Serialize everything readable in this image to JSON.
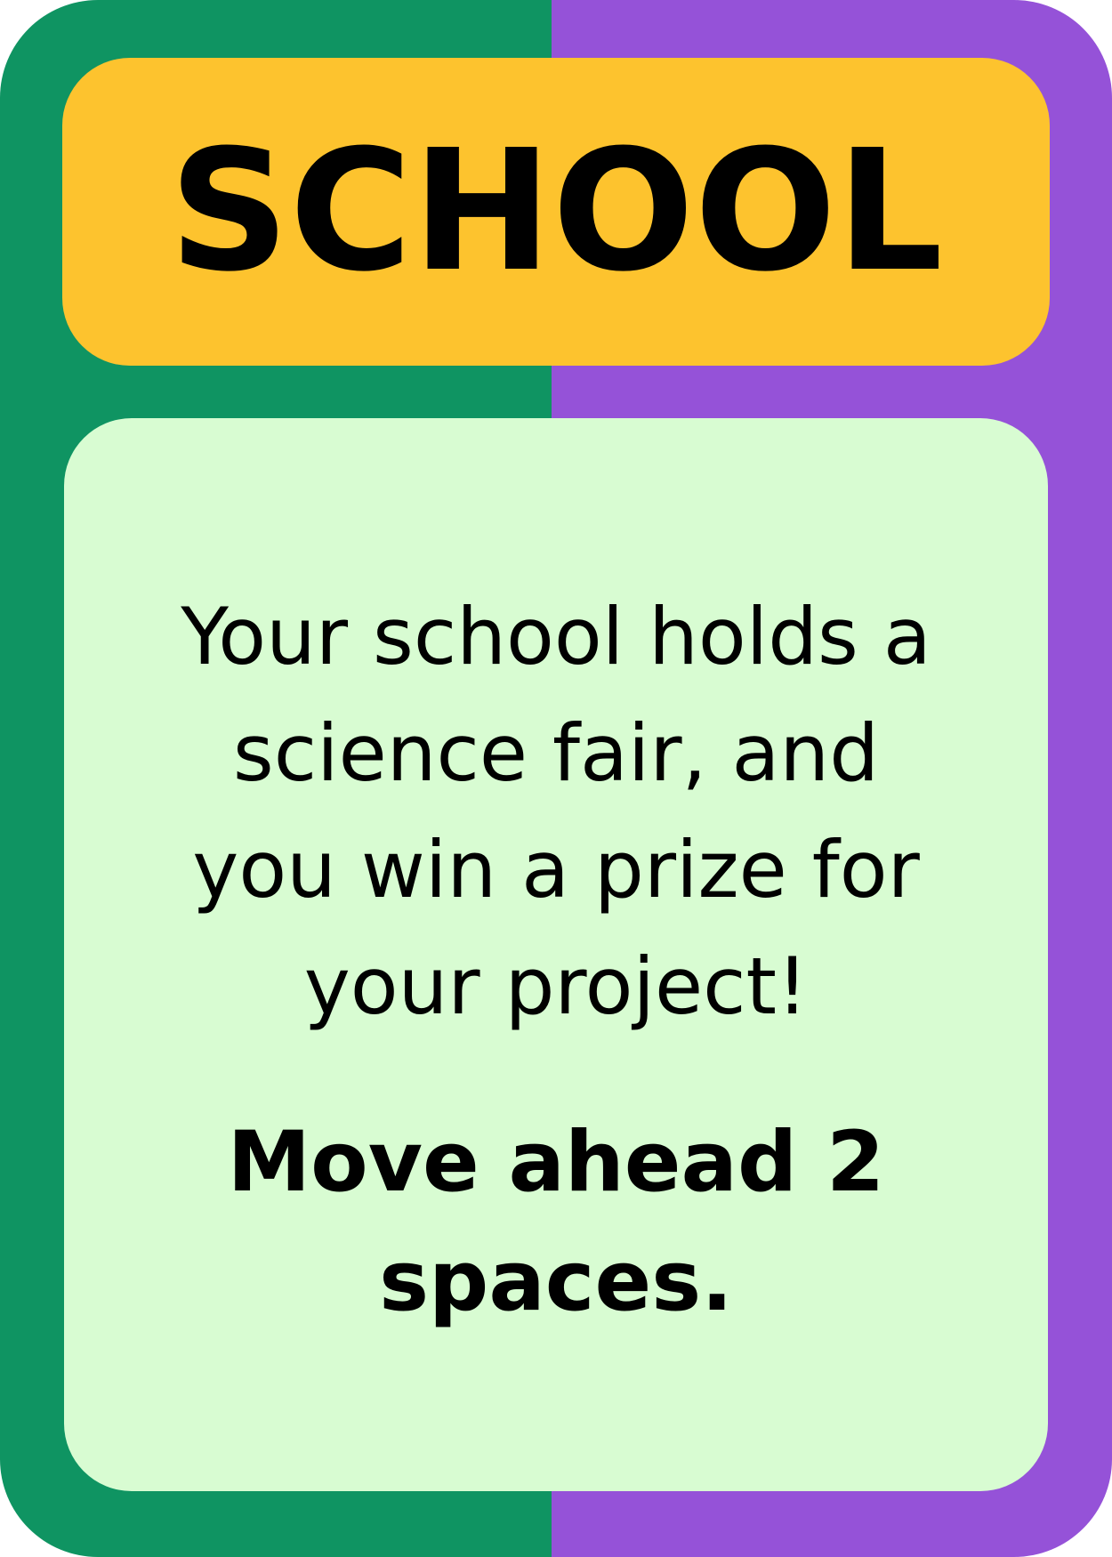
{
  "card": {
    "category": "SCHOOL",
    "event_lines": [
      "Your school holds a",
      "science fair, and",
      "you win a prize for",
      "your project!"
    ],
    "action_lines": [
      "Move ahead 2",
      "spaces."
    ]
  },
  "colors": {
    "left_border": "#0f9462",
    "right_border": "#9552d8",
    "header_background": "#fdc32e",
    "body_background": "#d8fcd2",
    "text": "#000000"
  }
}
